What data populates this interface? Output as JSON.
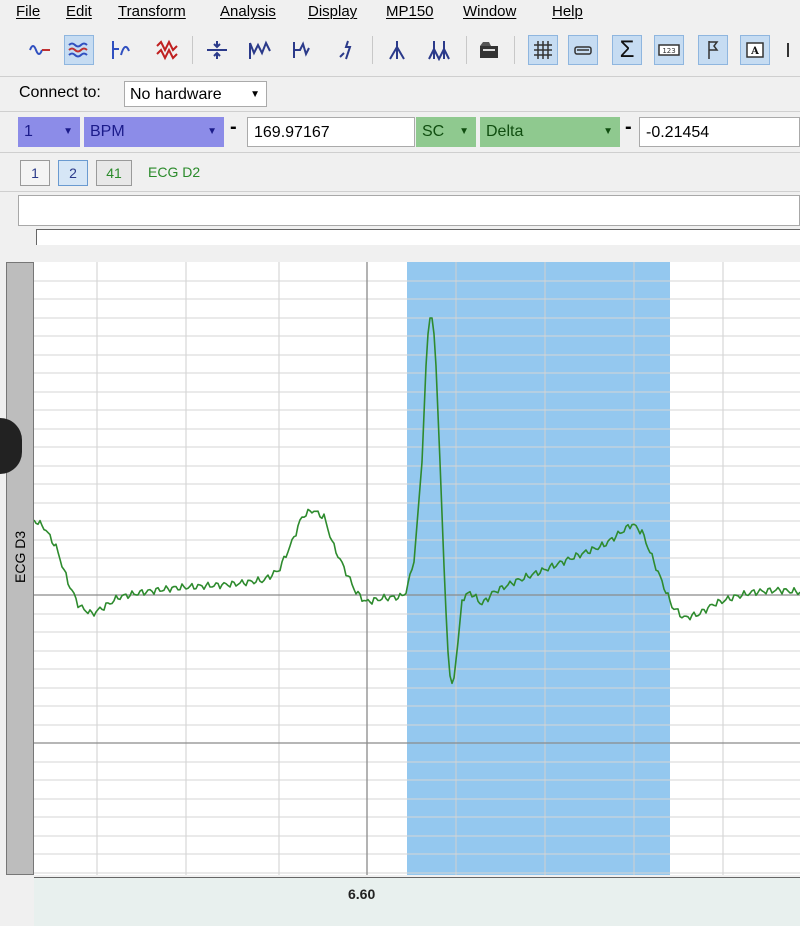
{
  "menu": [
    "File",
    "Edit",
    "Transform",
    "Analysis",
    "Display",
    "MP150",
    "Window",
    "Help"
  ],
  "toolbar_icons": [
    "waveform-arrange-icon",
    "overlap-waveforms-icon",
    "xy-plot-icon",
    "red-waveforms-icon",
    "autoscale-horizontal-icon",
    "autoscale-vertical-icon",
    "zoom-icon",
    "cursor-adjust-icon",
    "peak-detect-icon",
    "multi-peak-icon",
    "open-folder-icon",
    "grid-icon",
    "chart-icon",
    "sigma-icon",
    "digital-display-icon",
    "marker-flag-icon",
    "label-icon"
  ],
  "connect": {
    "label": "Connect to:",
    "value": "No hardware"
  },
  "measurement1": {
    "channel": "1",
    "type": "BPM",
    "value": "169.97167"
  },
  "measurement2": {
    "channel": "SC",
    "type": "Delta",
    "value": "-0.21454"
  },
  "channels": {
    "buttons": [
      "1",
      "2",
      "41"
    ],
    "selected_label": "ECG D2"
  },
  "strip_label": "ECG D3",
  "time_axis": {
    "tick": "6.60"
  },
  "colors": {
    "waveform": "#2e8b2e",
    "selection": "#5aaae6",
    "grid": "#cfcfcf",
    "grid_major": "#8a8a8a"
  }
}
